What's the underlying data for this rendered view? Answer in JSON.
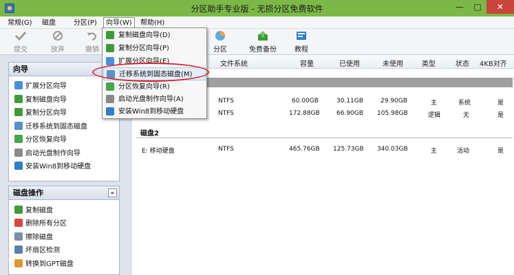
{
  "window": {
    "title": "分区助手专业版 - 无损分区免费软件",
    "minimize": "—",
    "maximize": "□",
    "close": "✕"
  },
  "menubar": [
    {
      "label": "常规(G)"
    },
    {
      "label": "磁盘"
    },
    {
      "label": "分区(P)"
    },
    {
      "label": "向导(W)"
    },
    {
      "label": "帮助(H)"
    }
  ],
  "toolbar": {
    "submit": "提交",
    "discard": "放弃",
    "undo": "撤销",
    "partition": "分区",
    "free_backup": "免费备份",
    "tutorial": "教程"
  },
  "wizard_menu": {
    "items": [
      {
        "label": "复制磁盘向导(D)"
      },
      {
        "label": "复制分区向导(P)"
      },
      {
        "label": "扩展分区向导(E)"
      },
      {
        "label": "迁移系统到固态磁盘(M)"
      },
      {
        "label": "分区恢复向导(R)"
      },
      {
        "label": "启动光盘制作向导(A)"
      },
      {
        "label": "安装Win8到移动硬盘"
      }
    ]
  },
  "sidebar": {
    "wizard_panel": {
      "title": "向导",
      "items": [
        {
          "label": "扩展分区向导"
        },
        {
          "label": "复制磁盘向导"
        },
        {
          "label": "复制分区向导"
        },
        {
          "label": "迁移系统到固态磁盘"
        },
        {
          "label": "分区恢复向导"
        },
        {
          "label": "启动光盘制作向导"
        },
        {
          "label": "安装Win8到移动硬盘"
        }
      ]
    },
    "disk_ops_panel": {
      "title": "磁盘操作",
      "collapse": "«",
      "items": [
        {
          "label": "复制磁盘"
        },
        {
          "label": "删除所有分区"
        },
        {
          "label": "擦除磁盘"
        },
        {
          "label": "坏扇区检测"
        },
        {
          "label": "转换到GPT磁盘"
        }
      ]
    }
  },
  "table": {
    "headers": {
      "fs": "文件系统",
      "capacity": "容量",
      "used": "已使用",
      "free": "未使用",
      "type": "类型",
      "status": "状态",
      "align": "4KB对齐"
    },
    "disk1_rows": [
      {
        "fs": "NTFS",
        "capacity": "60.00GB",
        "used": "30.11GB",
        "free": "29.90GB",
        "type": "主",
        "status": "系统",
        "align": "是"
      },
      {
        "fs": "NTFS",
        "capacity": "172.88GB",
        "used": "66.90GB",
        "free": "105.98GB",
        "type": "逻辑",
        "status": "无",
        "align": "是"
      }
    ],
    "disk2_label": "磁盘2",
    "disk2_rows": [
      {
        "name": "E: 移动硬盘",
        "fs": "NTFS",
        "capacity": "465.76GB",
        "used": "125.73GB",
        "free": "340.03GB",
        "type": "主",
        "status": "活动",
        "align": "是"
      }
    ]
  },
  "colors": {
    "accent_green": "#7cb847",
    "highlight_oval": "#d8232a",
    "menu_hover": "#e5eef9"
  }
}
